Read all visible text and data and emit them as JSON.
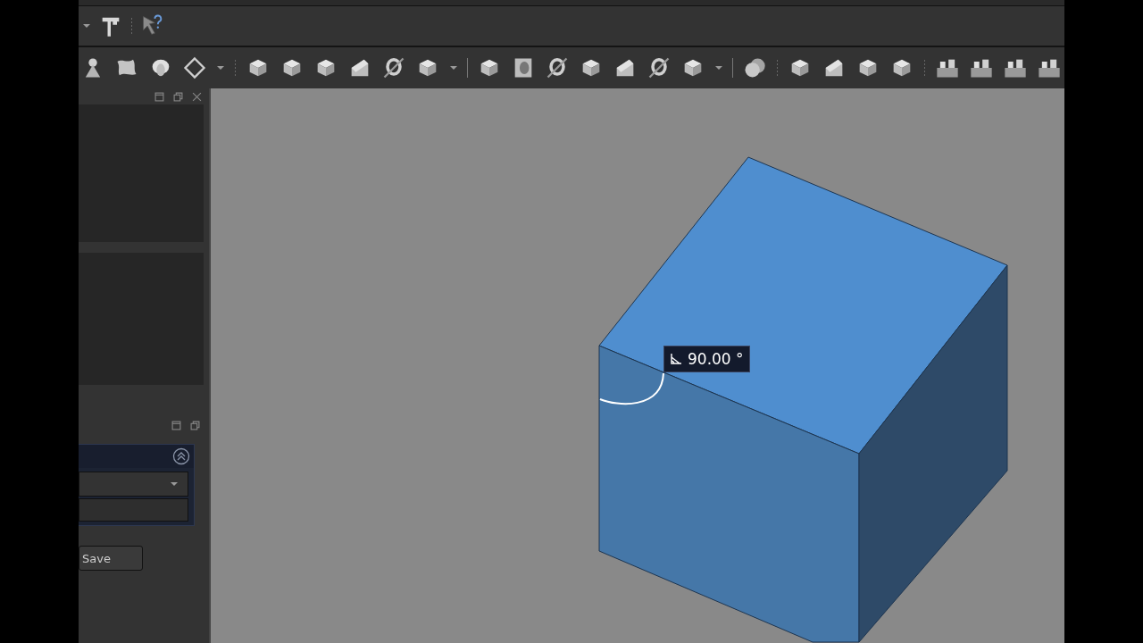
{
  "viewport": {
    "angle_label": {
      "value": "90.00 °"
    }
  },
  "task_panel": {
    "save_button": "Save"
  }
}
